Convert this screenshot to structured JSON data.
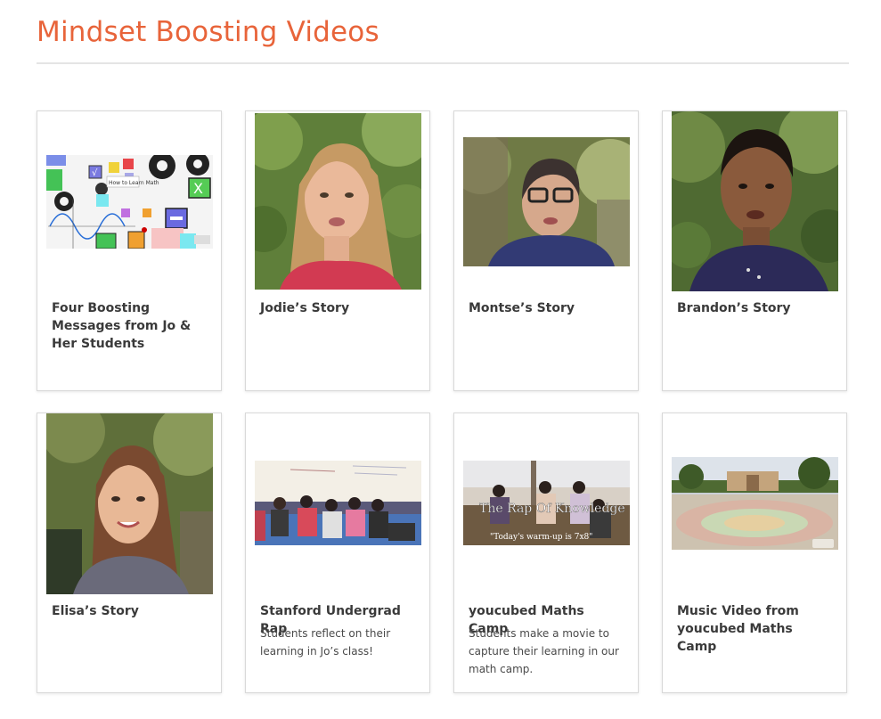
{
  "page": {
    "title": "Mindset Boosting Videos"
  },
  "colors": {
    "accent": "#e8643a",
    "card_border": "#d9d9d9",
    "rule": "#e4e4e4"
  },
  "cards": [
    {
      "title": "Four Boosting Messages from Jo & Her Students",
      "thumbnail": "gears-animation-thumbnail",
      "thumb_text": "How to Learn Math"
    },
    {
      "title": "Jodie’s Story",
      "thumbnail": "jodie-portrait-thumbnail"
    },
    {
      "title": "Montse’s Story",
      "thumbnail": "montse-portrait-thumbnail"
    },
    {
      "title": "Brandon’s Story",
      "thumbnail": "brandon-portrait-thumbnail"
    },
    {
      "title": "Elisa’s Story",
      "thumbnail": "elisa-portrait-thumbnail"
    },
    {
      "title": "Stanford Undergrad Rap",
      "description": "Students reflect on their learning in Jo’s class!",
      "thumbnail": "classroom-students-thumbnail"
    },
    {
      "title": "youcubed Maths Camp",
      "description": "Students make a movie to capture their learning in our math camp.",
      "thumbnail": "rap-of-knowledge-thumbnail",
      "overlay_title": "The Rap Of Knowledge",
      "overlay_caption": "\"Today's warm-up is 7x8\""
    },
    {
      "title": "Music Video from youcubed Maths Camp",
      "thumbnail": "campus-plaza-thumbnail"
    }
  ]
}
